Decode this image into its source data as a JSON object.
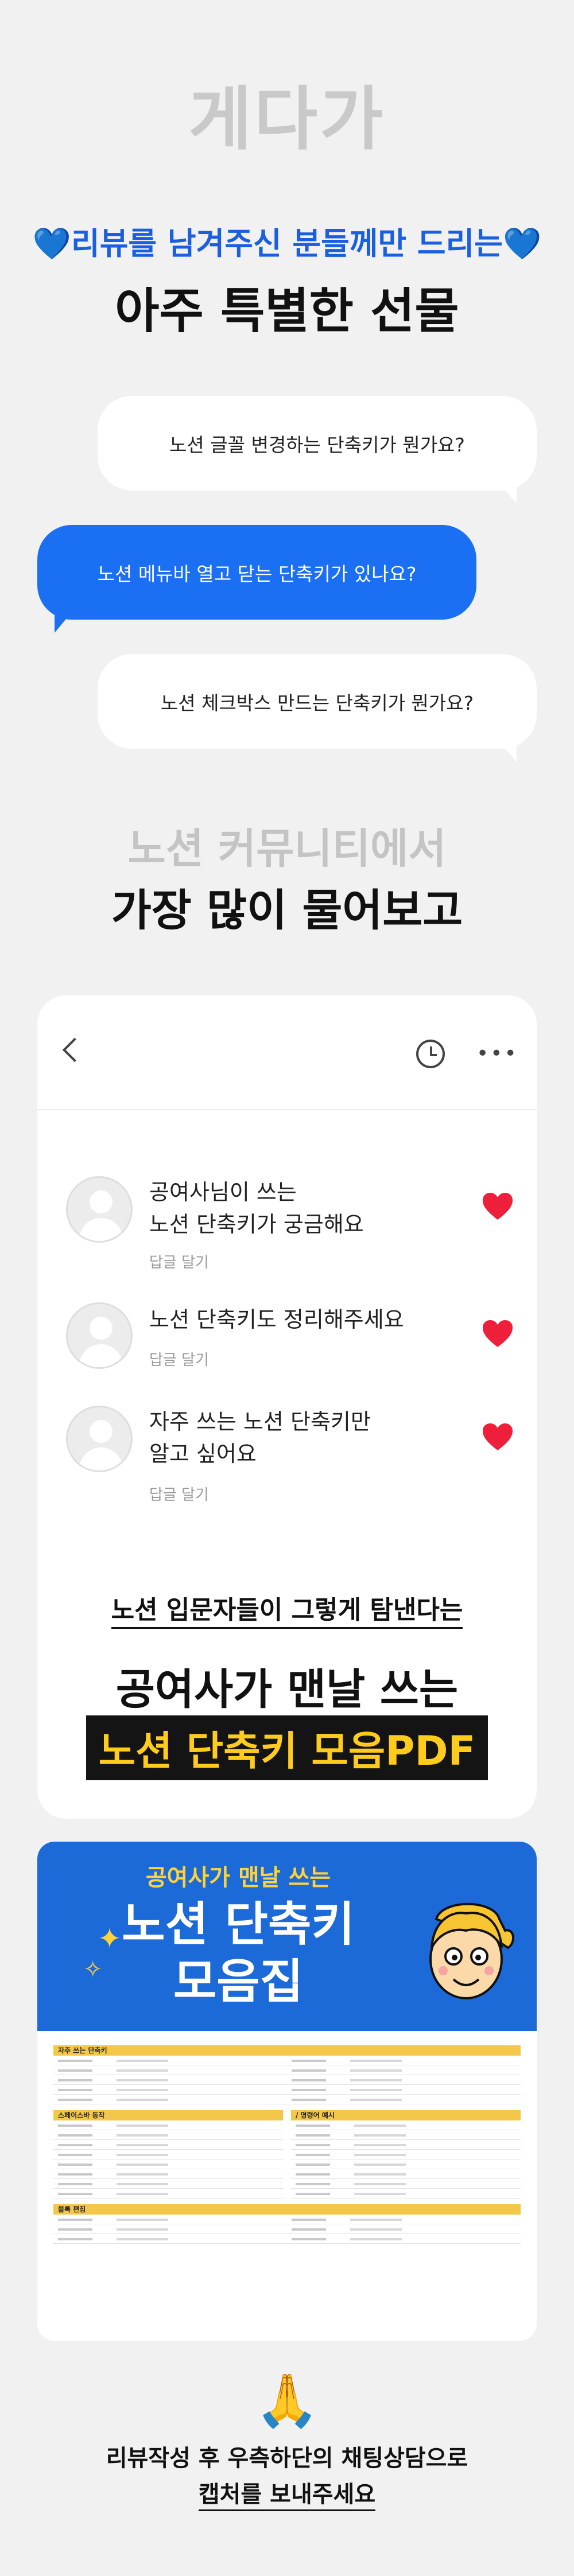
{
  "brand": "게다가",
  "promo": {
    "heart": "💙",
    "subtitle": "리뷰를 남겨주신 분들께만 드리는",
    "title": "아주 특별한 선물"
  },
  "chat": {
    "q1": "노션 글꼴 변경하는 단축키가 뭔가요?",
    "q2": "노션 메뉴바 열고 닫는 단축키가 있나요?",
    "q3": "노션 체크박스 만드는 단축키가 뭔가요?"
  },
  "section": {
    "gray": "노션 커뮤니티에서",
    "dark": "가장 많이 물어보고"
  },
  "phone": {
    "comments": [
      {
        "line1": "공여사님이 쓰는",
        "line2": "노션 단축키가 궁금해요",
        "reply": "답글 달기"
      },
      {
        "line1": "노션 단축키도 정리해주세요",
        "line2": "",
        "reply": "답글 달기"
      },
      {
        "line1": "자주 쓰는 노션 단축키만",
        "line2": "알고 싶어요",
        "reply": "답글 달기"
      }
    ],
    "intro": "노션 입문자들이 그렇게 탐낸다는",
    "big": "공여사가 맨날 쓰는",
    "highlight": "노션 단축키 모음PDF"
  },
  "book": {
    "sub": "공여사가 맨날 쓰는",
    "title1": "노션 단축키",
    "title2": "모음집",
    "sections": {
      "s1": "자주 쓰는 단축키",
      "s2": "스페이스바 동작",
      "s3": "/ 명령어 예시",
      "s4": "블록 편집"
    }
  },
  "footer": {
    "icon": "🙏",
    "line1": "리뷰작성 후 우측하단의 채팅상담으로",
    "line2": "캡처를 보내주세요"
  },
  "colors": {
    "accent_blue": "#1b6ff2",
    "highlight_yellow": "#ffcc1e",
    "heart_red": "#ee1f3b"
  }
}
